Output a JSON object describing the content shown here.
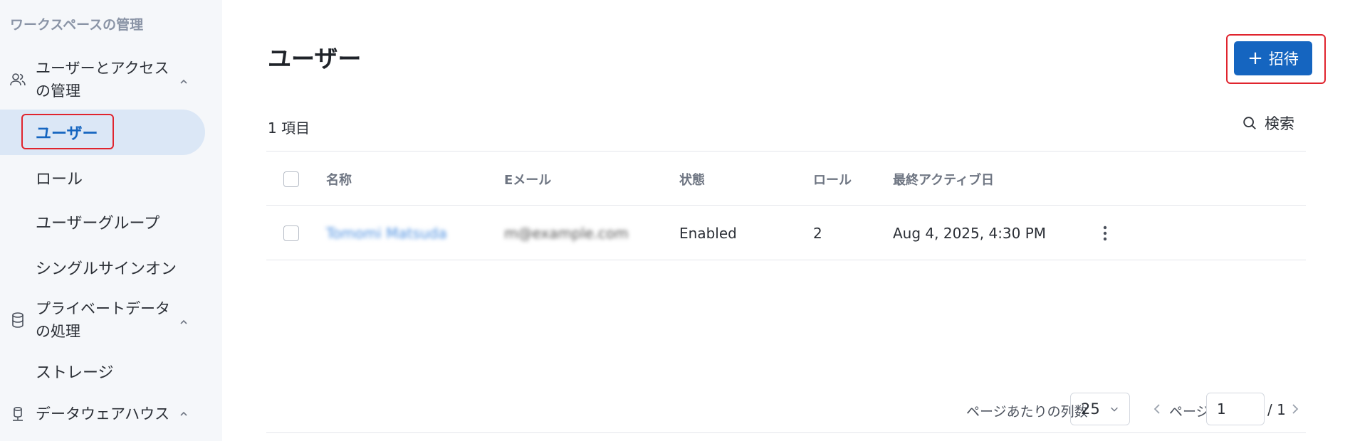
{
  "sidebar": {
    "workspace_title": "ワークスペースの管理",
    "groups": [
      {
        "label_line1": "ユーザーとアクセス",
        "label_line2": "の管理",
        "icon": "users-icon"
      },
      {
        "label_line1": "プライベートデータ",
        "label_line2": "の処理",
        "icon": "database-icon"
      },
      {
        "label_line1": "データウェアハウス",
        "icon": "warehouse-icon"
      }
    ],
    "items": [
      {
        "label": "ユーザー",
        "active": true
      },
      {
        "label": "ロール"
      },
      {
        "label": "ユーザーグループ"
      },
      {
        "label": "シングルサインオン"
      },
      {
        "label": "ストレージ"
      }
    ]
  },
  "main": {
    "title": "ユーザー",
    "invite_label": "招待",
    "item_count": "1 項目",
    "search_label": "検索",
    "columns": [
      "名称",
      "Eメール",
      "状態",
      "ロール",
      "最終アクティブ日"
    ],
    "rows": [
      {
        "name": "Tomomi Matsuda",
        "email": "m@example.com",
        "status": "Enabled",
        "roles": "2",
        "last_active": "Aug 4, 2025, 4:30 PM"
      }
    ],
    "pagination": {
      "per_page_label": "ページあたりの列数",
      "per_page_value": "25",
      "page_label": "ページ",
      "page_value": "1",
      "page_total": "/ 1"
    }
  },
  "colors": {
    "accent": "#1565c0",
    "highlight": "#e0242e",
    "sidebar_bg": "#f5f7fa",
    "active_bg": "#dbe7f6"
  }
}
